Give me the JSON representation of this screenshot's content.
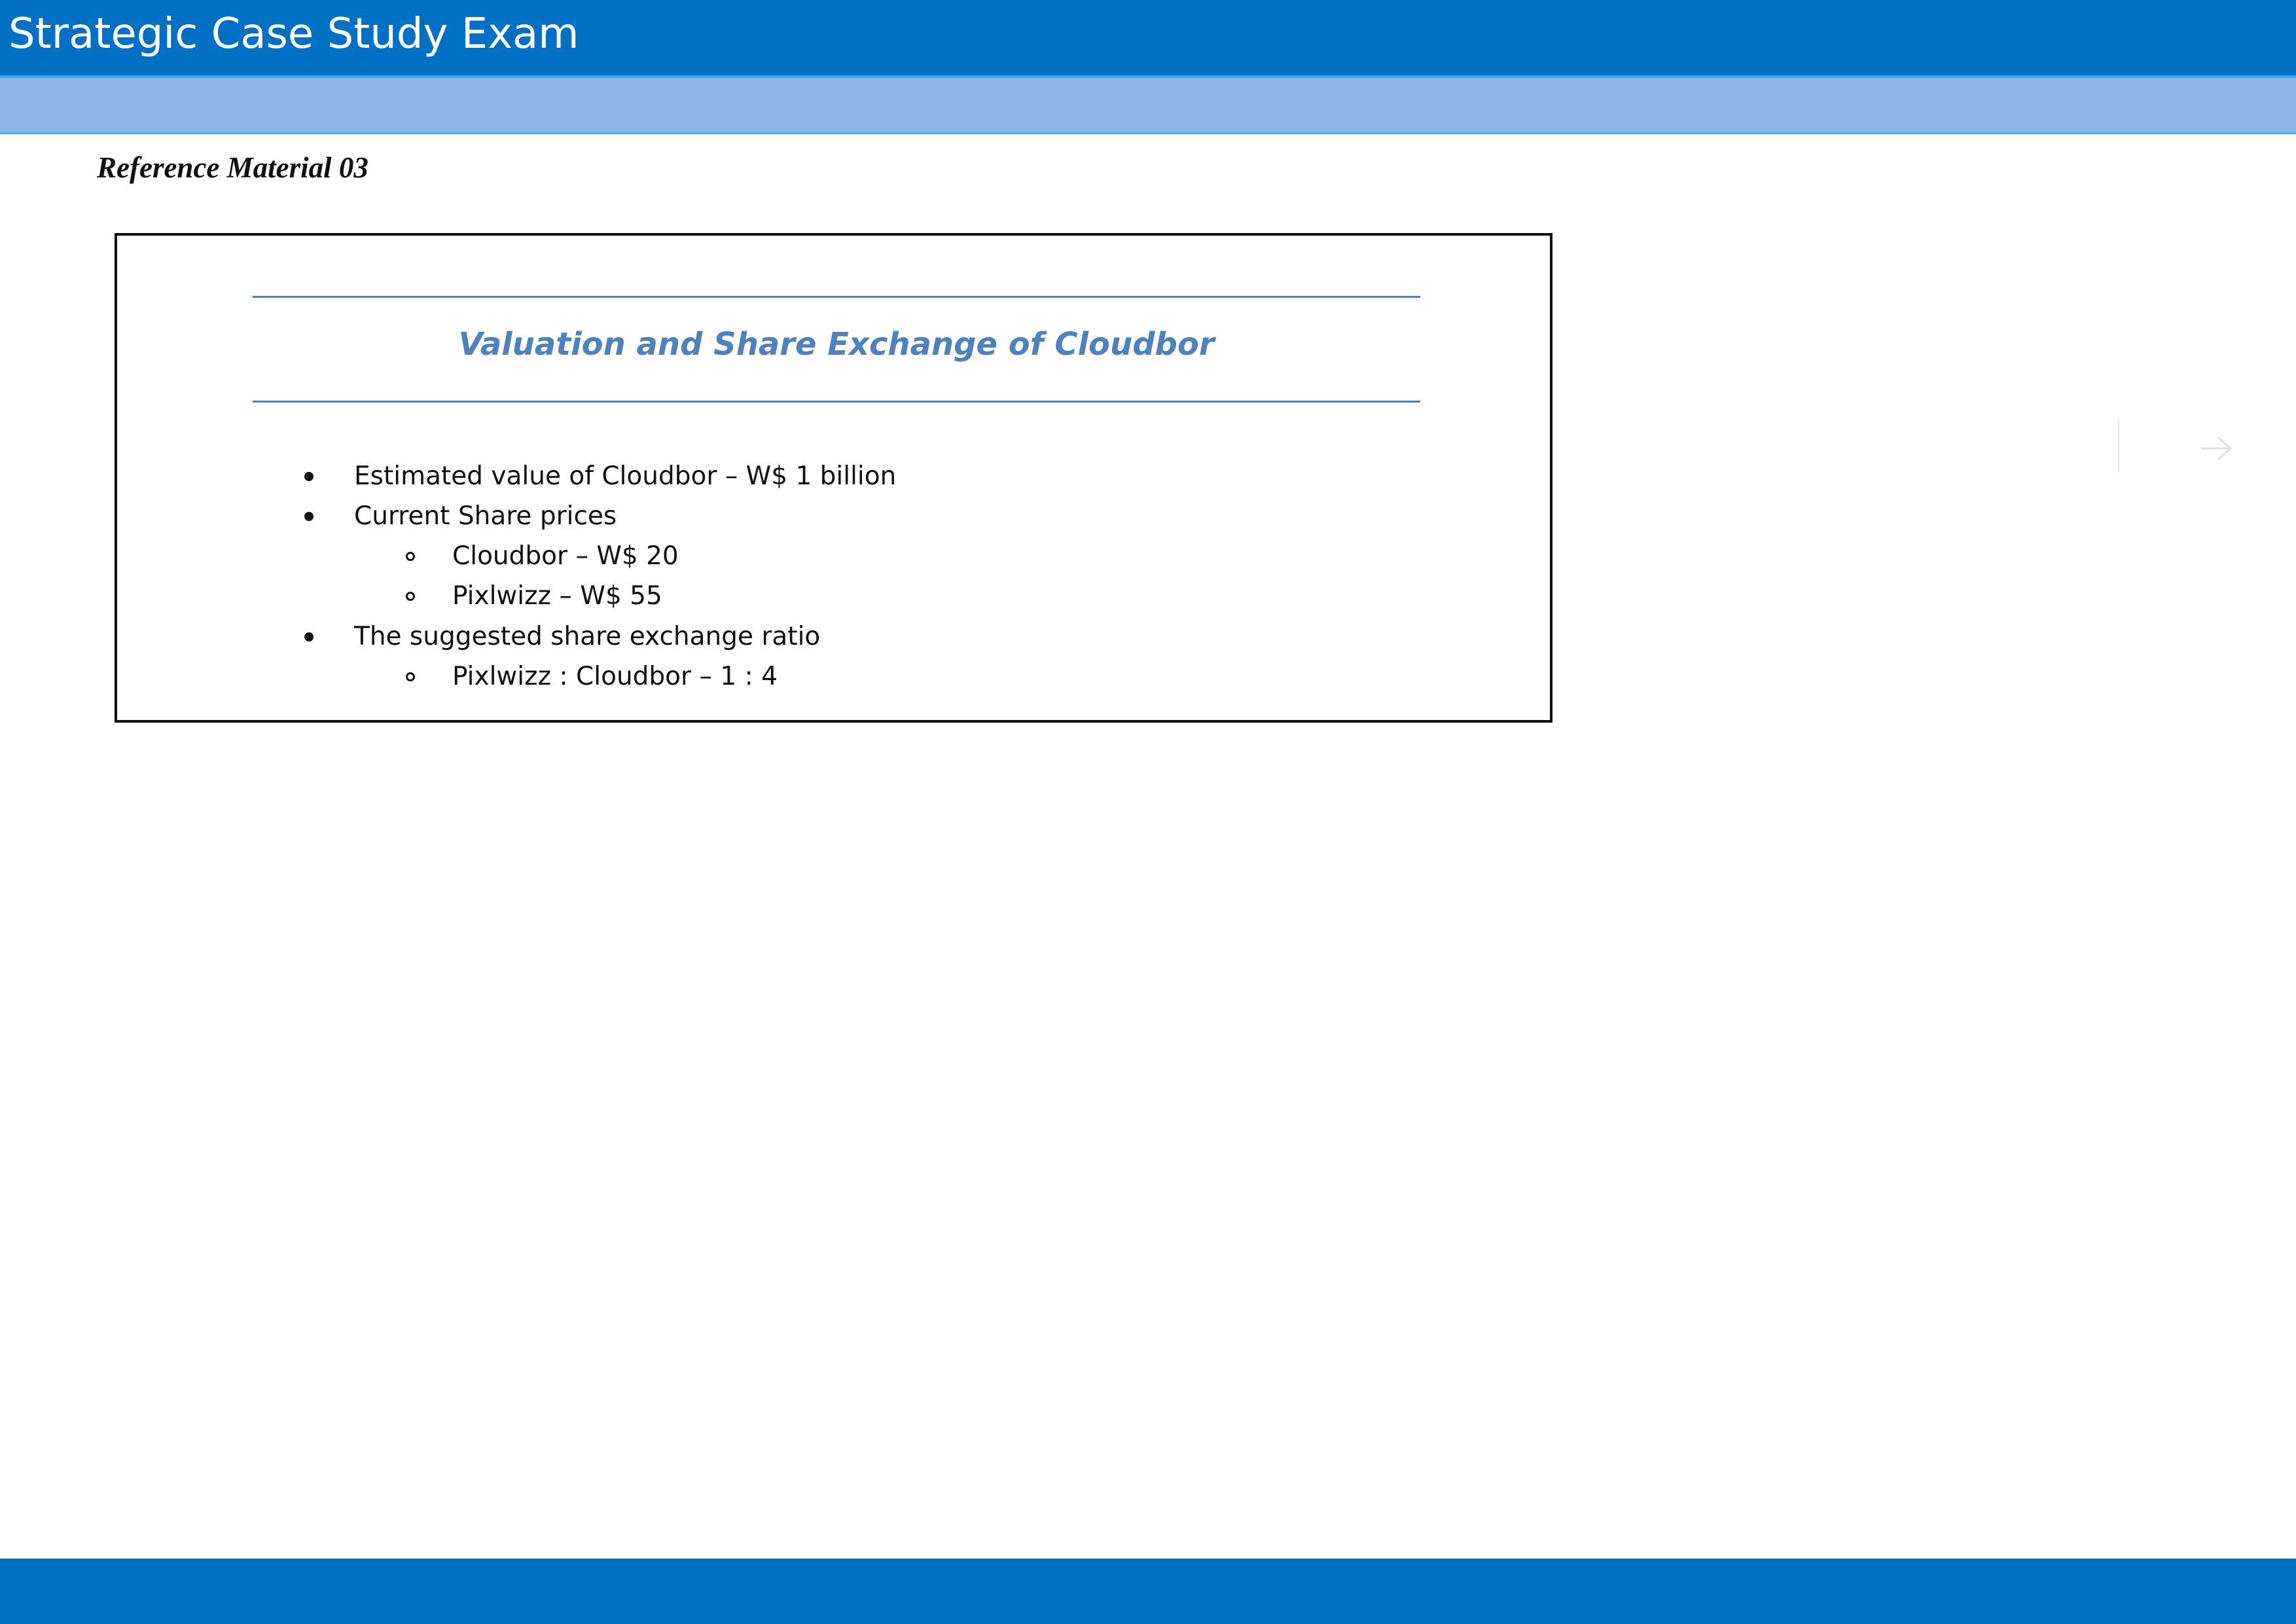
{
  "header": {
    "title": "Strategic Case Study Exam"
  },
  "reference": {
    "label": "Reference Material 03"
  },
  "card": {
    "heading": "Valuation and Share Exchange of Cloudbor",
    "items": [
      {
        "level": 1,
        "text": "Estimated value of Cloudbor – W$ 1 billion"
      },
      {
        "level": 1,
        "text": "Current Share prices"
      },
      {
        "level": 2,
        "text": "Cloudbor – W$ 20"
      },
      {
        "level": 2,
        "text": "Pixlwizz – W$ 55"
      },
      {
        "level": 1,
        "text": "The suggested share exchange ratio"
      },
      {
        "level": 2,
        "text": "Pixlwizz : Cloudbor – 1 : 4"
      }
    ]
  },
  "navigation": {
    "next_icon": "arrow-right-icon"
  },
  "colors": {
    "header_bar": "#0070c4",
    "sub_bar": "#8fb5e8",
    "heading_blue": "#4f81bd",
    "footer_bar": "#0070c4"
  }
}
